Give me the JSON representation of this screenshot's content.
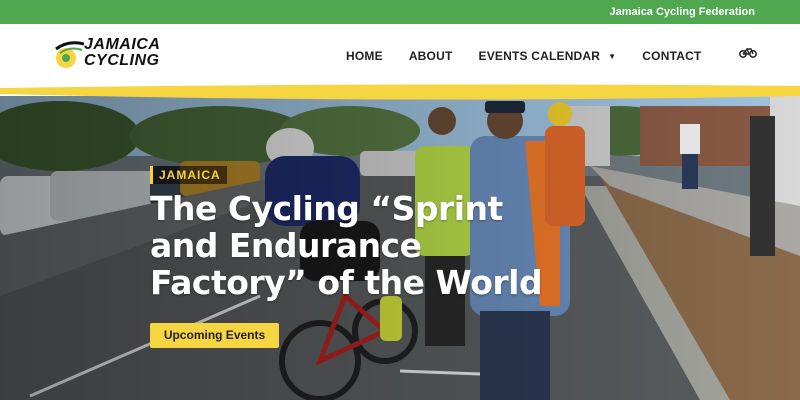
{
  "topbar": {
    "federation": "Jamaica Cycling Federation"
  },
  "brand": {
    "line1": "JAMAICA",
    "line2": "CYCLING"
  },
  "nav": {
    "home": "HOME",
    "about": "ABOUT",
    "events_calendar": "EVENTS CALENDAR",
    "contact": "CONTACT"
  },
  "hero": {
    "tag": "JAMAICA",
    "headline": "The Cycling “Sprint and Endurance Factory” of the World",
    "cta": "Upcoming Events"
  },
  "colors": {
    "green": "#4fa84f",
    "yellow": "#f5d542",
    "white": "#ffffff"
  },
  "icons": {
    "cart": "bicycle-icon",
    "dropdown": "chevron-down-icon"
  }
}
